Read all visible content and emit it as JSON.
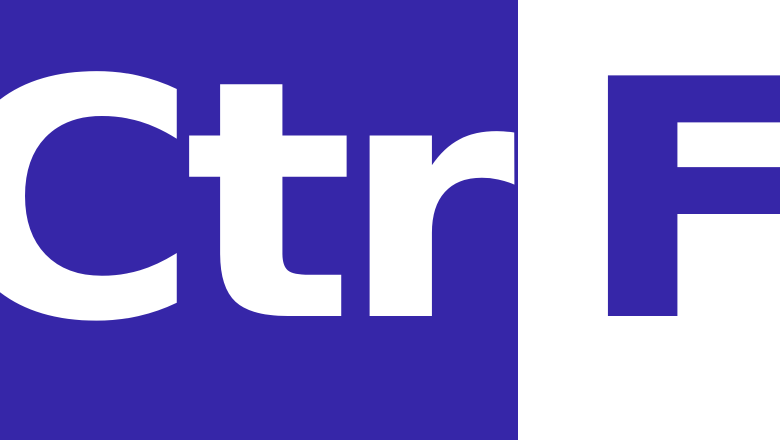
{
  "logo": {
    "left_text": "Ctrl",
    "right_text": "F"
  },
  "colors": {
    "brand_blue": "#3626a8",
    "white": "#ffffff"
  }
}
